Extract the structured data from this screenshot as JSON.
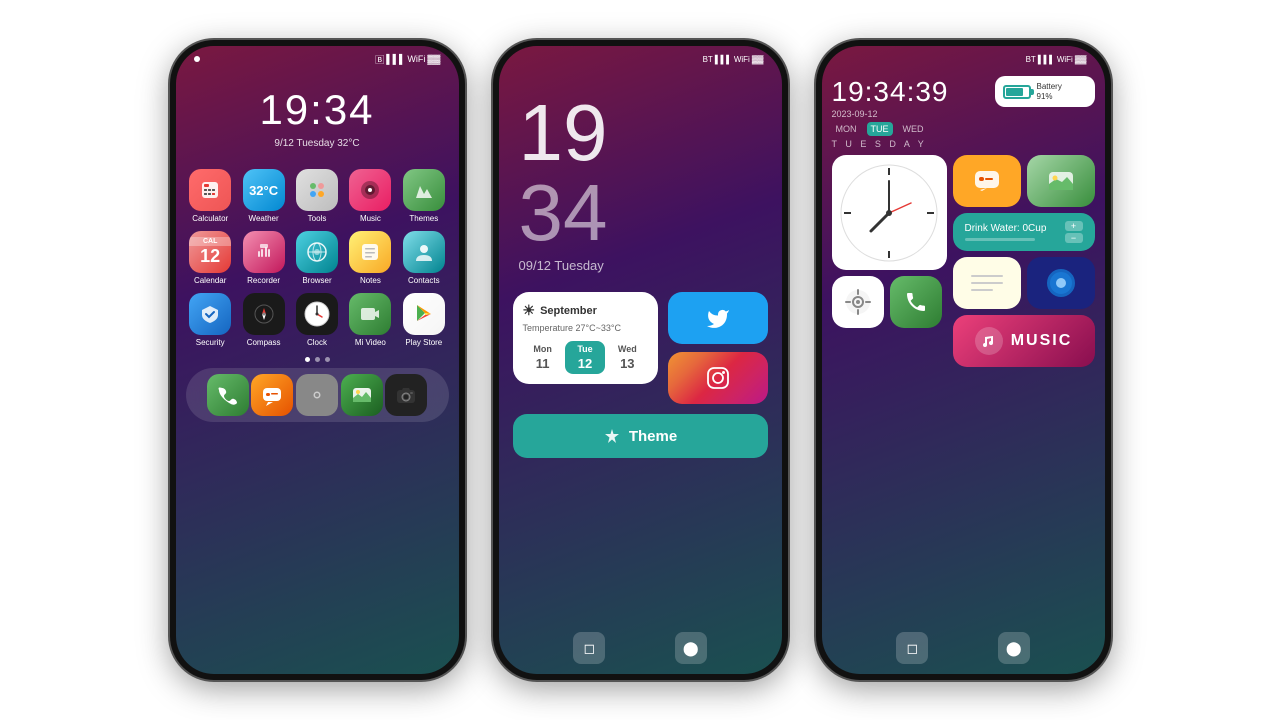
{
  "phone1": {
    "status": {
      "bluetooth": "BT",
      "signal": "▌▌▌",
      "wifi": "WiFi",
      "battery": "▓▓▓"
    },
    "time": "19:34",
    "date": "9/12  Tuesday  32°C",
    "apps_row1": [
      {
        "id": "calculator",
        "label": "Calculator",
        "icon": "🧮",
        "color": "icon-calc"
      },
      {
        "id": "weather",
        "label": "Weather",
        "icon": "🌡",
        "color": "icon-weather"
      },
      {
        "id": "tools",
        "label": "Tools",
        "icon": "⚙",
        "color": "icon-tools"
      },
      {
        "id": "music",
        "label": "Music",
        "icon": "🎵",
        "color": "icon-music"
      },
      {
        "id": "themes",
        "label": "Themes",
        "icon": "✏",
        "color": "icon-themes"
      }
    ],
    "apps_row2": [
      {
        "id": "calendar",
        "label": "Calendar",
        "icon": "📅",
        "color": "icon-calendar"
      },
      {
        "id": "recorder",
        "label": "Recorder",
        "icon": "🎙",
        "color": "icon-recorder"
      },
      {
        "id": "browser",
        "label": "Browser",
        "icon": "🌐",
        "color": "icon-browser"
      },
      {
        "id": "notes",
        "label": "Notes",
        "icon": "📝",
        "color": "icon-notes"
      },
      {
        "id": "contacts",
        "label": "Contacts",
        "icon": "👤",
        "color": "icon-contacts"
      }
    ],
    "apps_row3": [
      {
        "id": "security",
        "label": "Security",
        "icon": "🛡",
        "color": "icon-security"
      },
      {
        "id": "compass",
        "label": "Compass",
        "icon": "🧭",
        "color": "icon-compass"
      },
      {
        "id": "clock",
        "label": "Clock",
        "icon": "⏰",
        "color": "icon-clock"
      },
      {
        "id": "mivideo",
        "label": "Mi Video",
        "icon": "▶",
        "color": "icon-mivideo"
      },
      {
        "id": "playstore",
        "label": "Play Store",
        "icon": "▶",
        "color": "icon-playstore"
      }
    ],
    "dock": [
      {
        "id": "phone",
        "icon": "📞",
        "color": "icon-phone-app"
      },
      {
        "id": "messages",
        "icon": "💬",
        "color": "icon-msg-app"
      },
      {
        "id": "settings",
        "icon": "⚙",
        "color": "icon-settings-app"
      },
      {
        "id": "gallery",
        "icon": "🖼",
        "color": "icon-gallery-app"
      },
      {
        "id": "camera",
        "icon": "📷",
        "color": "icon-camera-app"
      }
    ]
  },
  "phone2": {
    "hour": "19",
    "minute": "34",
    "date": "09/12 Tuesday",
    "weather_month": "September",
    "weather_temp": "Temperature 27°C~33°C",
    "days": [
      {
        "name": "Mon",
        "num": "11",
        "today": false
      },
      {
        "name": "Tue",
        "num": "12",
        "today": true
      },
      {
        "name": "Wed",
        "num": "13",
        "today": false
      }
    ],
    "theme_label": "Theme",
    "nav_square": "■",
    "nav_circle": "⬤"
  },
  "phone3": {
    "time": "19:34:39",
    "date": "2023-09-12",
    "week_days": [
      "MON",
      "TUE",
      "WED"
    ],
    "today_index": 1,
    "day_name": "T U E S D A Y",
    "battery_label": "Battery",
    "battery_pct": "91%",
    "water_text": "Drink Water: 0Cup",
    "music_label": "MUSIC"
  }
}
